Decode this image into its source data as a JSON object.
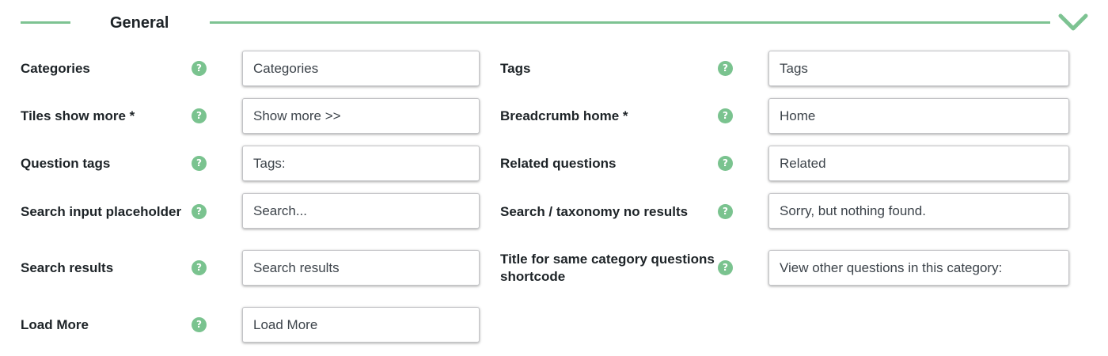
{
  "theme": {
    "accent": "#7dc392",
    "help_icon_color": "#7ac38f",
    "text": "#1d2327",
    "input_border": "#c3c4c7"
  },
  "section": {
    "title": "General",
    "toggle_icon": "chevron-down-icon"
  },
  "help": {
    "glyph": "?",
    "icon": "help-icon"
  },
  "fields": {
    "categories": {
      "label": "Categories",
      "value": "Categories"
    },
    "tags": {
      "label": "Tags",
      "value": "Tags"
    },
    "tiles_show_more": {
      "label": "Tiles show more *",
      "value": "Show more >>"
    },
    "breadcrumb_home": {
      "label": "Breadcrumb home *",
      "value": "Home"
    },
    "question_tags": {
      "label": "Question tags",
      "value": "Tags:"
    },
    "related_questions": {
      "label": "Related questions",
      "value": "Related"
    },
    "search_input_placeholder": {
      "label": "Search input placeholder",
      "value": "Search..."
    },
    "search_taxonomy_no_results": {
      "label": "Search / taxonomy no results",
      "value": "Sorry, but nothing found."
    },
    "search_results": {
      "label": "Search results",
      "value": "Search results"
    },
    "same_category_title": {
      "label_line1": "Title for same category questions",
      "label_line2": "shortcode",
      "value": "View other questions in this category:"
    },
    "load_more": {
      "label": "Load More",
      "value": "Load More"
    }
  }
}
